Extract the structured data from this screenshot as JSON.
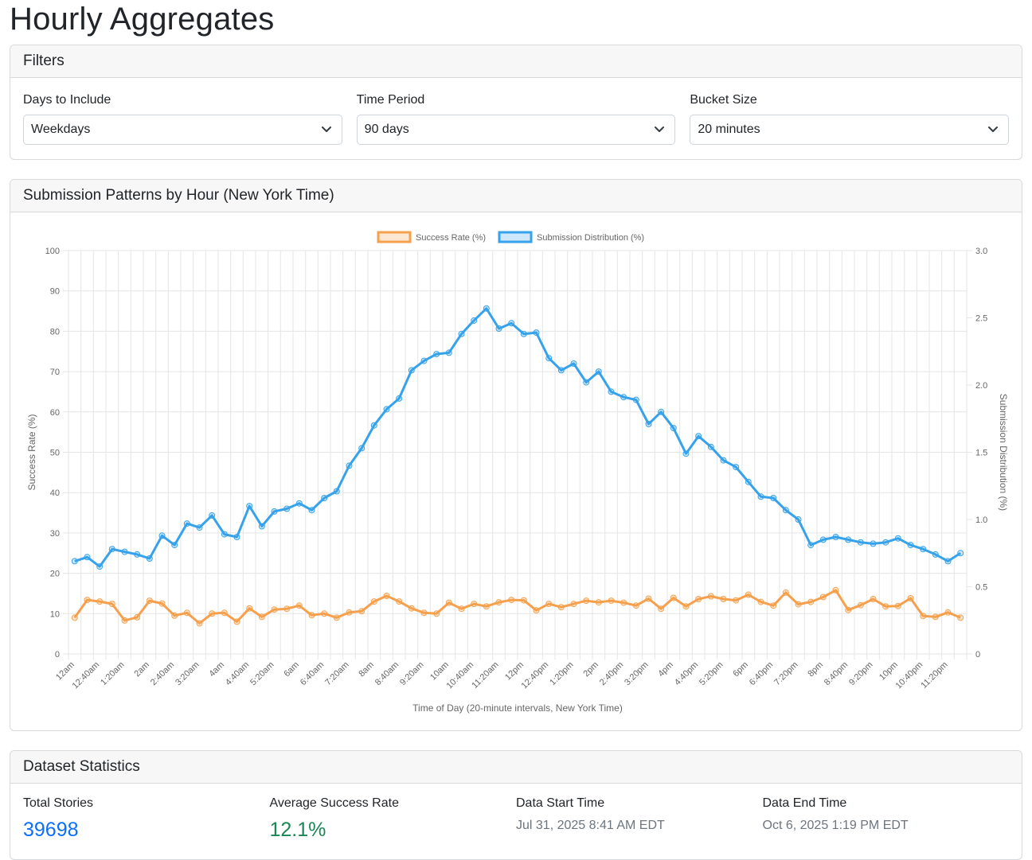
{
  "page": {
    "title": "Hourly Aggregates"
  },
  "filters": {
    "header": "Filters",
    "days": {
      "label": "Days to Include",
      "value": "Weekdays"
    },
    "period": {
      "label": "Time Period",
      "value": "90 days"
    },
    "bucket": {
      "label": "Bucket Size",
      "value": "20 minutes"
    }
  },
  "chart_card": {
    "header": "Submission Patterns by Hour (New York Time)"
  },
  "colors": {
    "success": "#f6a04d",
    "distribution": "#36a2eb",
    "link_blue": "#0d6efd",
    "success_green": "#198754"
  },
  "chart_data": {
    "type": "line",
    "xlabel": "Time of Day (20-minute intervals, New York Time)",
    "ylabel_left": "Success Rate (%)",
    "ylabel_right": "Submission Distribution (%)",
    "ylim_left": [
      0,
      100
    ],
    "ylim_right": [
      0,
      3.0
    ],
    "yticks_left": [
      0,
      10,
      20,
      30,
      40,
      50,
      60,
      70,
      80,
      90,
      100
    ],
    "yticks_right": [
      "0",
      "0.5",
      "1.0",
      "1.5",
      "2.0",
      "2.5",
      "3.0"
    ],
    "grid": true,
    "legend_position": "top",
    "categories": [
      "12am",
      "12:20am",
      "12:40am",
      "1am",
      "1:20am",
      "1:40am",
      "2am",
      "2:20am",
      "2:40am",
      "3am",
      "3:20am",
      "3:40am",
      "4am",
      "4:20am",
      "4:40am",
      "5am",
      "5:20am",
      "5:40am",
      "6am",
      "6:20am",
      "6:40am",
      "7am",
      "7:20am",
      "7:40am",
      "8am",
      "8:20am",
      "8:40am",
      "9am",
      "9:20am",
      "9:40am",
      "10am",
      "10:20am",
      "10:40am",
      "11am",
      "11:20am",
      "11:40am",
      "12pm",
      "12:20pm",
      "12:40pm",
      "1pm",
      "1:20pm",
      "1:40pm",
      "2pm",
      "2:20pm",
      "2:40pm",
      "3pm",
      "3:20pm",
      "3:40pm",
      "4pm",
      "4:20pm",
      "4:40pm",
      "5pm",
      "5:20pm",
      "5:40pm",
      "6pm",
      "6:20pm",
      "6:40pm",
      "7pm",
      "7:20pm",
      "7:40pm",
      "8pm",
      "8:20pm",
      "8:40pm",
      "9pm",
      "9:20pm",
      "9:40pm",
      "10pm",
      "10:20pm",
      "10:40pm",
      "11pm",
      "11:20pm",
      "11:40pm"
    ],
    "tick_labels": [
      "12am",
      "12:40am",
      "1:20am",
      "2am",
      "2:40am",
      "3:20am",
      "4am",
      "4:40am",
      "5:20am",
      "6am",
      "6:40am",
      "7:20am",
      "8am",
      "8:40am",
      "9:20am",
      "10am",
      "10:40am",
      "11:20am",
      "12pm",
      "12:40pm",
      "1:20pm",
      "2pm",
      "2:40pm",
      "3:20pm",
      "4pm",
      "4:40pm",
      "5:20pm",
      "6pm",
      "6:40pm",
      "7:20pm",
      "8pm",
      "8:40pm",
      "9:20pm",
      "10pm",
      "10:40pm",
      "11:20pm"
    ],
    "series": [
      {
        "name": "Success Rate (%)",
        "axis": "left",
        "values": [
          9.0,
          13.4,
          13.0,
          12.4,
          8.3,
          9.1,
          13.2,
          12.5,
          9.5,
          10.2,
          7.6,
          10.0,
          10.2,
          8.0,
          11.3,
          9.2,
          11.0,
          11.2,
          12.0,
          9.6,
          10.0,
          9.0,
          10.3,
          10.6,
          13.0,
          14.4,
          13.0,
          11.3,
          10.2,
          10.0,
          12.7,
          11.2,
          12.4,
          11.8,
          12.8,
          13.4,
          13.3,
          10.8,
          12.4,
          11.6,
          12.4,
          13.2,
          12.8,
          13.2,
          12.7,
          12.0,
          13.7,
          11.2,
          13.9,
          11.8,
          13.6,
          14.3,
          13.6,
          13.3,
          14.7,
          12.9,
          12.0,
          15.2,
          12.3,
          12.9,
          14.1,
          15.8,
          10.9,
          12.1,
          13.6,
          11.8,
          11.9,
          13.8,
          9.4,
          9.2,
          10.3,
          9.0
        ]
      },
      {
        "name": "Submission Distribution (%)",
        "axis": "right",
        "values": [
          0.69,
          0.72,
          0.65,
          0.78,
          0.76,
          0.74,
          0.71,
          0.88,
          0.81,
          0.97,
          0.94,
          1.03,
          0.89,
          0.87,
          1.1,
          0.95,
          1.06,
          1.08,
          1.12,
          1.07,
          1.16,
          1.21,
          1.4,
          1.53,
          1.7,
          1.82,
          1.9,
          2.11,
          2.18,
          2.23,
          2.24,
          2.38,
          2.48,
          2.57,
          2.42,
          2.46,
          2.38,
          2.39,
          2.2,
          2.11,
          2.16,
          2.02,
          2.1,
          1.95,
          1.91,
          1.89,
          1.71,
          1.8,
          1.68,
          1.49,
          1.62,
          1.54,
          1.44,
          1.39,
          1.28,
          1.17,
          1.16,
          1.07,
          1.0,
          0.81,
          0.85,
          0.87,
          0.85,
          0.83,
          0.82,
          0.83,
          0.86,
          0.81,
          0.78,
          0.74,
          0.69,
          0.75
        ]
      }
    ]
  },
  "stats": {
    "header": "Dataset Statistics",
    "total_stories": {
      "label": "Total Stories",
      "value": "39698"
    },
    "avg_success": {
      "label": "Average Success Rate",
      "value": "12.1%"
    },
    "start_time": {
      "label": "Data Start Time",
      "value": "Jul 31, 2025 8:41 AM EDT"
    },
    "end_time": {
      "label": "Data End Time",
      "value": "Oct 6, 2025 1:19 PM EDT"
    }
  }
}
